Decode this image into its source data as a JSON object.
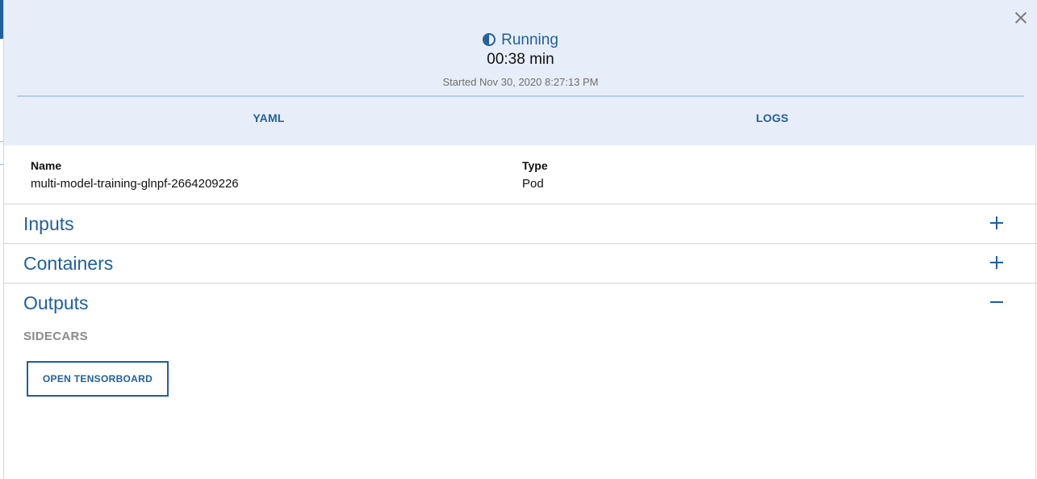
{
  "status": {
    "icon": "half-circle-status-icon",
    "label": "Running",
    "duration": "00:38 min",
    "started": "Started Nov 30, 2020 8:27:13 PM"
  },
  "tabs": [
    {
      "label": "YAML"
    },
    {
      "label": "LOGS"
    }
  ],
  "info": {
    "name_label": "Name",
    "name_value": "multi-model-training-glnpf-2664209226",
    "type_label": "Type",
    "type_value": "Pod"
  },
  "sections": [
    {
      "title": "Inputs",
      "toggle": "+"
    },
    {
      "title": "Containers",
      "toggle": "+"
    },
    {
      "title": "Outputs",
      "toggle": "−"
    }
  ],
  "outputs": {
    "sidecars_label": "SIDECARS",
    "button_label": "OPEN TENSORBOARD"
  },
  "colors": {
    "accent": "#1f5f9e",
    "header_bg": "#e8eef9"
  }
}
